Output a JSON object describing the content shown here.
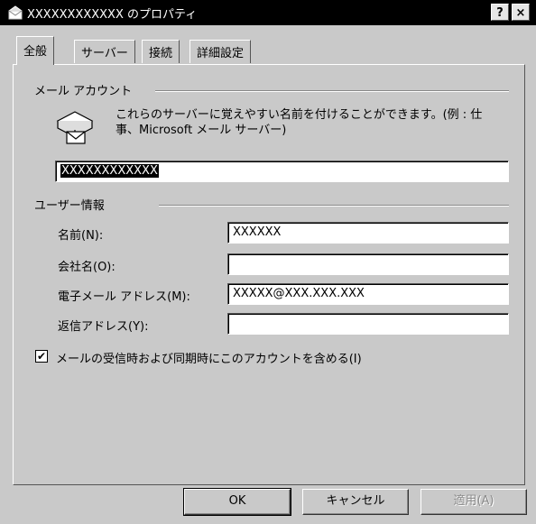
{
  "window": {
    "title": "XXXXXXXXXXXX のプロパティ",
    "help_button": "?",
    "close_button": "×"
  },
  "tabs": [
    {
      "label": "全般",
      "active": true
    },
    {
      "label": "サーバー",
      "active": false
    },
    {
      "label": "接続",
      "active": false
    },
    {
      "label": "詳細設定",
      "active": false
    }
  ],
  "mail_account": {
    "group_label": "メール アカウント",
    "description": "これらのサーバーに覚えやすい名前を付けることができます。(例 : 仕事、Microsoft メール サーバー)",
    "account_name": "XXXXXXXXXXXX"
  },
  "user_info": {
    "group_label": "ユーザー情報",
    "name_label": "名前(N):",
    "name_value": "XXXXXX",
    "company_label": "会社名(O):",
    "company_value": "",
    "email_label": "電子メール アドレス(M):",
    "email_value": "XXXXX@XXX.XXX.XXX",
    "reply_label": "返信アドレス(Y):",
    "reply_value": ""
  },
  "include_account": {
    "label": "メールの受信時および同期時にこのアカウントを含める(I)",
    "checked": true,
    "mark": "✔"
  },
  "buttons": {
    "ok": "OK",
    "cancel": "キャンセル",
    "apply": "適用(A)"
  }
}
